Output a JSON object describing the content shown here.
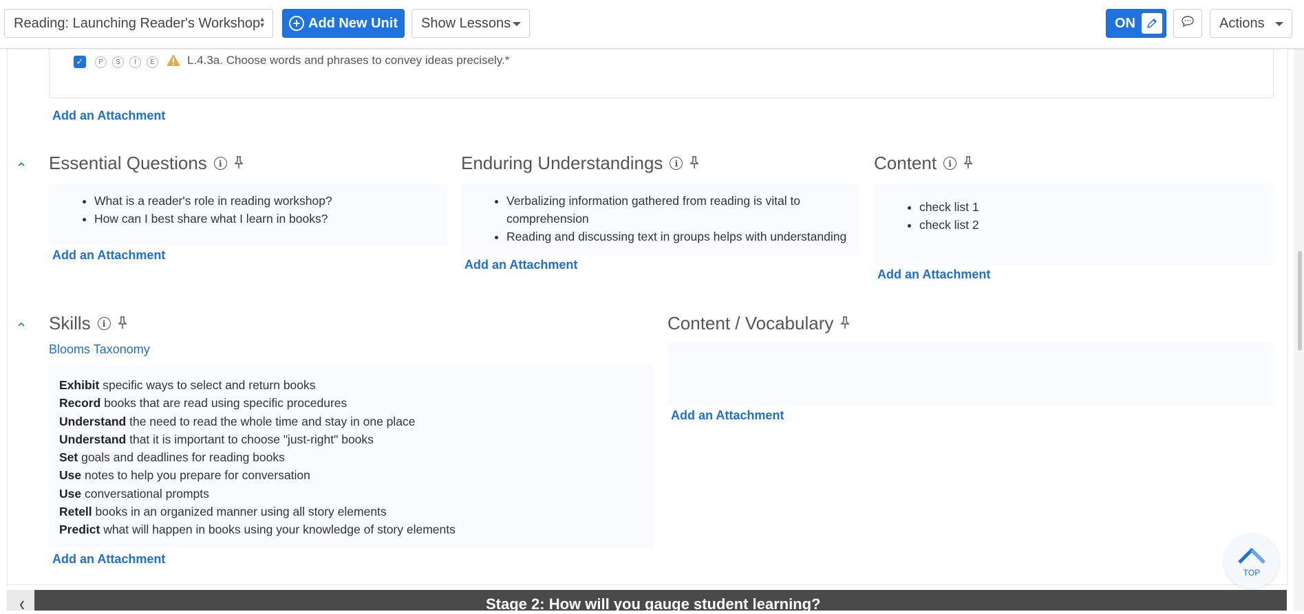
{
  "toolbar": {
    "unit_select_value": "Reading: Launching Reader's Workshop",
    "add_unit_label": "Add New Unit",
    "show_lessons_label": "Show Lessons",
    "toggle_label": "ON",
    "actions_label": "Actions",
    "accent_color": "#1e73de"
  },
  "standards": {
    "codes": [
      "P",
      "S",
      "I",
      "E"
    ],
    "checked": true,
    "text": "L.4.3a. Choose words and phrases to convey ideas precisely.*",
    "attachment_label": "Add an Attachment"
  },
  "essential_questions": {
    "title": "Essential Questions",
    "items": [
      "What is a reader's role in reading workshop?",
      "How can I best share what I learn in books?"
    ],
    "attachment_label": "Add an Attachment"
  },
  "enduring_understandings": {
    "title": "Enduring Understandings",
    "items": [
      "Verbalizing information gathered from reading is vital to comprehension",
      "Reading and discussing text in groups helps with understanding"
    ],
    "attachment_label": "Add an Attachment"
  },
  "content": {
    "title": "Content",
    "items": [
      "check list 1",
      "check list 2"
    ],
    "attachment_label": "Add an Attachment"
  },
  "skills": {
    "title": "Skills",
    "taxonomy_link": "Blooms Taxonomy",
    "items": [
      {
        "verb": "Exhibit",
        "rest": " specific ways to select and return books"
      },
      {
        "verb": "Record",
        "rest": " books that are read using specific procedures"
      },
      {
        "verb": "Understand",
        "rest": " the need to read the whole time and stay in one place"
      },
      {
        "verb": "Understand",
        "rest": " that it is important to choose \"just-right\" books"
      },
      {
        "verb": "Set",
        "rest": " goals and deadlines for reading books"
      },
      {
        "verb": "Use",
        "rest": " notes to help you prepare for conversation"
      },
      {
        "verb": "Use",
        "rest": " conversational prompts"
      },
      {
        "verb": "Retell",
        "rest": " books in an organized manner using all story elements"
      },
      {
        "verb": "Predict",
        "rest": " what will happen in books using your knowledge of story elements"
      }
    ],
    "attachment_label": "Add an Attachment"
  },
  "content_vocabulary": {
    "title": "Content / Vocabulary",
    "attachment_label": "Add an Attachment"
  },
  "stage2": {
    "title": "Stage 2: How will you gauge student learning?"
  },
  "top_button": {
    "label": "TOP"
  }
}
